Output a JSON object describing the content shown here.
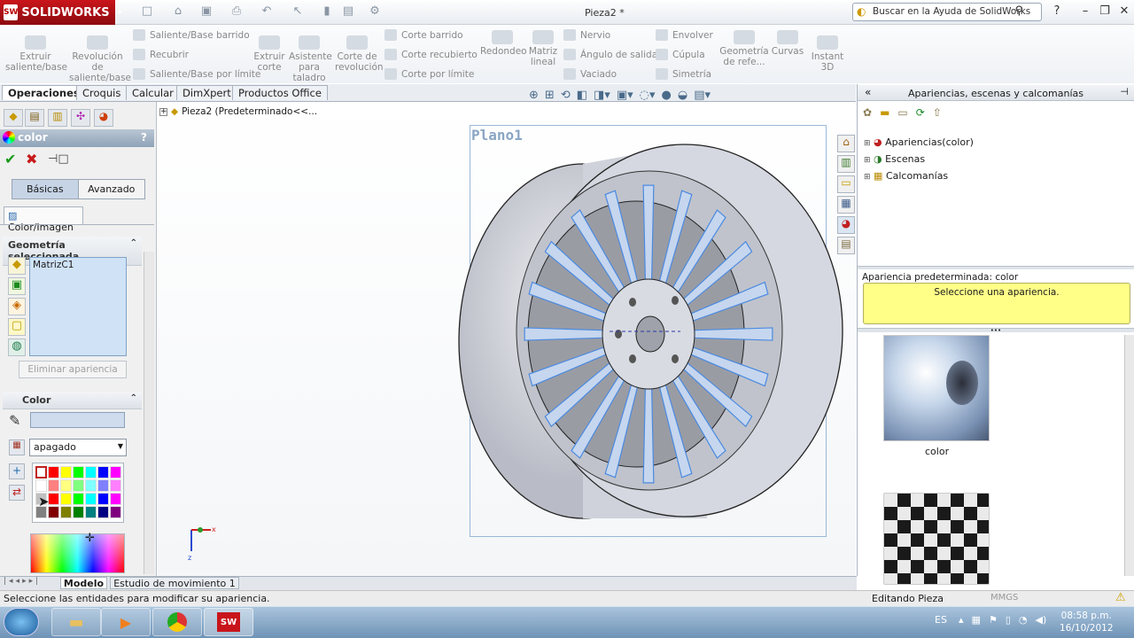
{
  "app": {
    "brand": "SOLIDWORKS",
    "brand_short": "SW",
    "window_title": "Pieza2 *"
  },
  "search": {
    "placeholder": "Buscar en la Ayuda de SolidWorks"
  },
  "ribbon": {
    "big": [
      "Extruir saliente/base",
      "Revolución de saliente/base",
      "Extruir corte",
      "Asistente para taladro",
      "Corte de revolución",
      "Redondeo",
      "Matriz lineal",
      "Geometría de refe...",
      "Curvas",
      "Instant 3D"
    ],
    "small": [
      "Saliente/Base barrido",
      "Recubrir",
      "Saliente/Base por límite",
      "Corte barrido",
      "Corte recubierto",
      "Corte por límite",
      "Nervio",
      "Ángulo de salida",
      "Vaciado",
      "Envolver",
      "Cúpula",
      "Simetría"
    ]
  },
  "tabs": [
    "Operaciones",
    "Croquis",
    "Calcular",
    "DimXpert",
    "Productos Office"
  ],
  "feature_tree": {
    "root": "Pieza2  (Predeterminado<<..."
  },
  "property_manager": {
    "title": "color",
    "help": "?",
    "toggle": [
      "Básicas",
      "Avanzado"
    ],
    "subtab": "Color/Imagen",
    "geom_header": "Geometría seleccionada",
    "geom_items": [
      "MatrizC1"
    ],
    "remove_btn": "Eliminar apariencia",
    "color_header": "Color",
    "dropdown": "apagado",
    "swatches": [
      "#ffffff",
      "#ff0000",
      "#ffff00",
      "#00ff00",
      "#00ffff",
      "#0000ff",
      "#ff00ff",
      "#ffffff",
      "#ff8080",
      "#ffff80",
      "#80ff80",
      "#80ffff",
      "#8080ff",
      "#ff80ff",
      "#c0c0c0",
      "#ff0000",
      "#ffff00",
      "#00ff00",
      "#00ffff",
      "#0000ff",
      "#ff00ff",
      "#808080",
      "#800000",
      "#808000",
      "#008000",
      "#008080",
      "#000080",
      "#800080",
      "#000000",
      "#400000",
      "#404000",
      "#004000",
      "#004040",
      "#000040",
      "#400040",
      "#000000"
    ]
  },
  "canvas": {
    "plane_label": "Plano1"
  },
  "right_panel": {
    "title": "Apariencias, escenas y calcomanías",
    "tree": [
      "Apariencias(color)",
      "Escenas",
      "Calcomanías"
    ],
    "default_label": "Apariencia predeterminada: color",
    "hint": "Seleccione una apariencia.",
    "thumbs": [
      "color"
    ]
  },
  "bottom_tabs": [
    "Modelo",
    "Estudio de movimiento 1"
  ],
  "status": {
    "message": "Seleccione las entidades para modificar su apariencia.",
    "mode": "Editando Pieza",
    "units": "MMGS"
  },
  "taskbar": {
    "lang": "ES",
    "time": "08:58 p.m.",
    "date": "16/10/2012"
  }
}
